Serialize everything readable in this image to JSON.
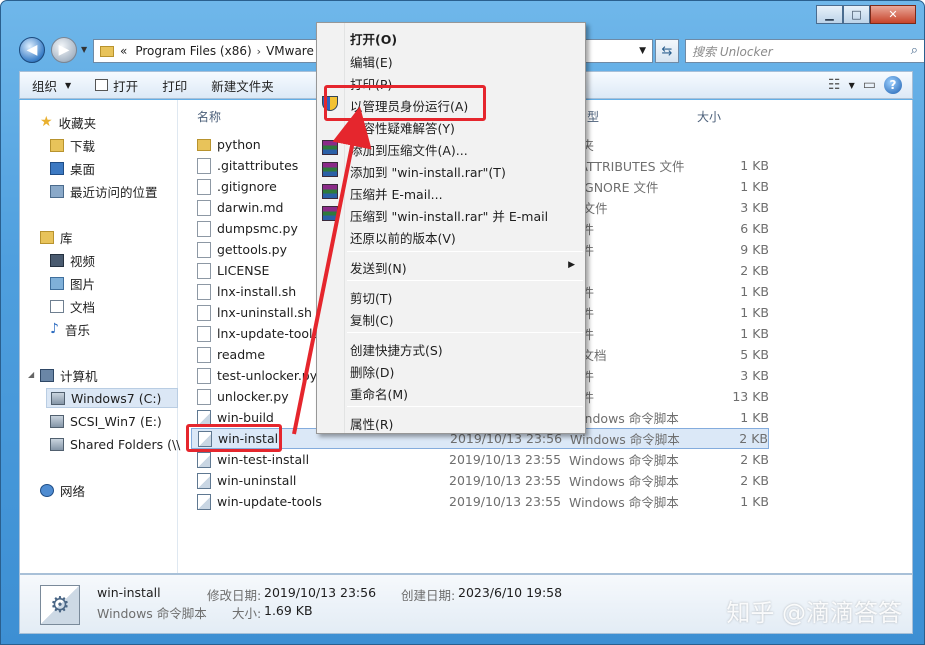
{
  "window": {
    "controls": {
      "minimize": "▁",
      "maximize": "□",
      "close": "✕"
    }
  },
  "address": {
    "prefix": "«",
    "crumbs": [
      "Program Files (x86)",
      "VMware"
    ],
    "separator": "›"
  },
  "search": {
    "placeholder": "搜索 Unlocker"
  },
  "toolbar": {
    "organize": "组织",
    "open": "打开",
    "print": "打印",
    "new_folder": "新建文件夹"
  },
  "nav_pane": {
    "favorites": "收藏夹",
    "downloads": "下载",
    "desktop": "桌面",
    "recent": "最近访问的位置",
    "libraries": "库",
    "videos": "视频",
    "pictures": "图片",
    "documents": "文档",
    "music": "音乐",
    "computer": "计算机",
    "drive_c": "Windows7 (C:)",
    "drive_e": "SCSI_Win7 (E:)",
    "shared": "Shared Folders (\\\\",
    "network": "网络"
  },
  "columns": {
    "name": "名称",
    "type": "型",
    "size": "大小"
  },
  "files": [
    {
      "name": "python",
      "date": "",
      "type": "件夹",
      "size": "",
      "icon": "folder"
    },
    {
      "name": ".gitattributes",
      "date": "",
      "type": "ITATTRIBUTES 文件",
      "size": "1 KB",
      "icon": "file"
    },
    {
      "name": ".gitignore",
      "date": "",
      "type": "ITIGNORE 文件",
      "size": "1 KB",
      "icon": "file"
    },
    {
      "name": "darwin.md",
      "date": "",
      "type": "D 文件",
      "size": "3 KB",
      "icon": "file"
    },
    {
      "name": "dumpsmc.py",
      "date": "",
      "type": "文件",
      "size": "6 KB",
      "icon": "file"
    },
    {
      "name": "gettools.py",
      "date": "",
      "type": "文件",
      "size": "9 KB",
      "icon": "file"
    },
    {
      "name": "LICENSE",
      "date": "",
      "type": "件",
      "size": "2 KB",
      "icon": "file"
    },
    {
      "name": "lnx-install.sh",
      "date": "",
      "type": "文件",
      "size": "1 KB",
      "icon": "file"
    },
    {
      "name": "lnx-uninstall.sh",
      "date": "",
      "type": "文件",
      "size": "1 KB",
      "icon": "file"
    },
    {
      "name": "lnx-update-tools",
      "date": "",
      "type": "文件",
      "size": "1 KB",
      "icon": "file"
    },
    {
      "name": "readme",
      "date": "",
      "type": "本文档",
      "size": "5 KB",
      "icon": "file"
    },
    {
      "name": "test-unlocker.py",
      "date": "",
      "type": "文件",
      "size": "3 KB",
      "icon": "file"
    },
    {
      "name": "unlocker.py",
      "date": "",
      "type": "文件",
      "size": "13 KB",
      "icon": "file"
    },
    {
      "name": "win-build",
      "date": "",
      "type": "Windows 命令脚本",
      "size": "1 KB",
      "icon": "script"
    },
    {
      "name": "win-install",
      "date": "2019/10/13 23:56",
      "type": "Windows 命令脚本",
      "size": "2 KB",
      "icon": "script",
      "selected": true
    },
    {
      "name": "win-test-install",
      "date": "2019/10/13 23:55",
      "type": "Windows 命令脚本",
      "size": "2 KB",
      "icon": "script"
    },
    {
      "name": "win-uninstall",
      "date": "2019/10/13 23:55",
      "type": "Windows 命令脚本",
      "size": "2 KB",
      "icon": "script"
    },
    {
      "name": "win-update-tools",
      "date": "2019/10/13 23:55",
      "type": "Windows 命令脚本",
      "size": "1 KB",
      "icon": "script"
    }
  ],
  "context_menu": {
    "open": "打开(O)",
    "edit": "编辑(E)",
    "print": "打印(P)",
    "run_as_admin": "以管理员身份运行(A)",
    "troubleshoot": "兼容性疑难解答(Y)",
    "add_to_archive": "添加到压缩文件(A)...",
    "add_to_rar": "添加到 \"win-install.rar\"(T)",
    "compress_email": "压缩并 E-mail...",
    "compress_rar_email": "压缩到 \"win-install.rar\" 并 E-mail",
    "restore": "还原以前的版本(V)",
    "send_to": "发送到(N)",
    "cut": "剪切(T)",
    "copy": "复制(C)",
    "shortcut": "创建快捷方式(S)",
    "delete": "删除(D)",
    "rename": "重命名(M)",
    "properties": "属性(R)"
  },
  "details": {
    "name": "win-install",
    "type": "Windows 命令脚本",
    "modified_label": "修改日期:",
    "modified": "2019/10/13 23:56",
    "size_label": "大小:",
    "size": "1.69 KB",
    "created_label": "创建日期:",
    "created": "2023/6/10 19:58"
  },
  "watermark": "知乎 @滴滴答答",
  "colors": {
    "highlight": "#e5262d",
    "selection": "#dbe8f7"
  }
}
